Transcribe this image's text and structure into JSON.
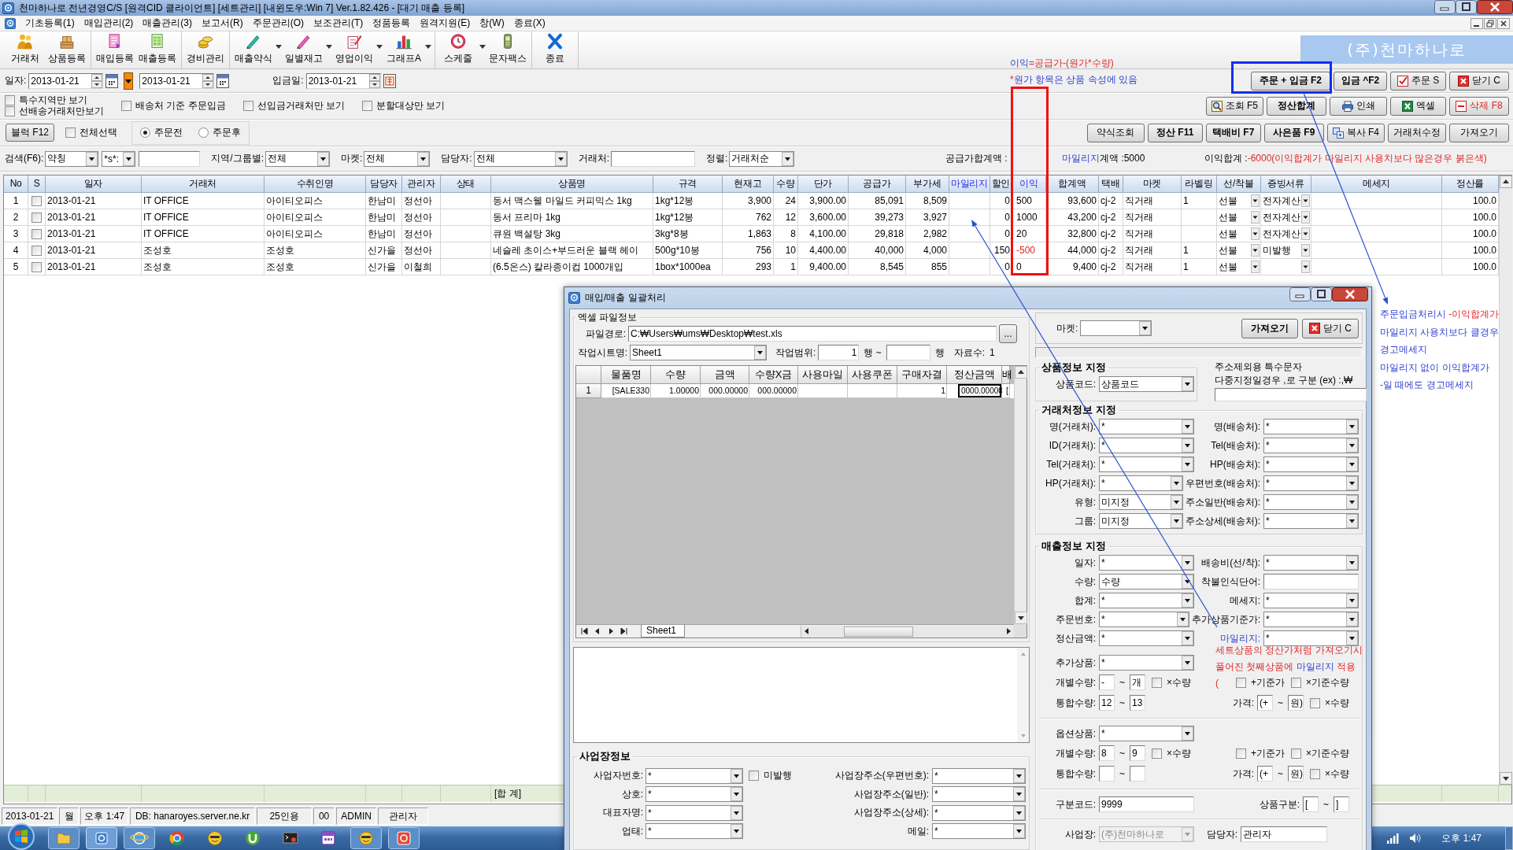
{
  "window": {
    "title": "천마하나로 전년경영C/S [원격CID 클라이언트] [세트관리] [내윈도우:Win 7] Ver.1.82.426 - [대기 매출 등록]",
    "menu": [
      "기초등록(1)",
      "매입관리(2)",
      "매출관리(3)",
      "보고서(R)",
      "주문관리(O)",
      "보조관리(T)",
      "정품등록",
      "원격지원(E)",
      "창(W)",
      "종료(X)"
    ]
  },
  "toolbar": [
    [
      {
        "label": "거래처",
        "kind": "customer",
        "dropdown": false
      },
      {
        "label": "상품등록",
        "kind": "product",
        "dropdown": false
      }
    ],
    [
      {
        "label": "매입등록",
        "kind": "purchase",
        "dropdown": false
      },
      {
        "label": "매출등록",
        "kind": "sales",
        "dropdown": false
      }
    ],
    [
      {
        "label": "경비관리",
        "kind": "expense",
        "dropdown": false
      }
    ],
    [
      {
        "label": "매출약식",
        "kind": "report",
        "dropdown": true
      },
      {
        "label": "일별재고",
        "kind": "stock",
        "dropdown": true
      },
      {
        "label": "영업이익",
        "kind": "profit",
        "dropdown": true
      },
      {
        "label": "그래프A",
        "kind": "graph",
        "dropdown": true
      }
    ],
    [
      {
        "label": "스케줄",
        "kind": "schedule",
        "dropdown": true
      },
      {
        "label": "문자팩스",
        "kind": "message",
        "dropdown": false
      }
    ],
    [
      {
        "label": "종료",
        "kind": "exit",
        "dropdown": false
      }
    ]
  ],
  "banner": "(주)천마하나로",
  "formula_note": [
    [
      {
        "text": "이익",
        "kind": "emphasis"
      },
      {
        "text": "=공급가-(원가*수량)",
        "kind": "warning"
      }
    ],
    [
      {
        "text": "*",
        "kind": "warning"
      },
      {
        "text": "원가 항목은 상품 속성에 있음",
        "kind": "emphasis"
      }
    ]
  ],
  "filters": {
    "date": {
      "label": "일자:",
      "from": "2013-01-21",
      "to": "2013-01-21"
    },
    "deposit": {
      "label": "입금일:",
      "value": "2013-01-21"
    },
    "checkbox_groups": [
      [
        {
          "label": "특수지역만 보기",
          "checked": false
        },
        {
          "label": "선배송거래처만보기",
          "checked": false
        }
      ],
      [
        {
          "label": "배송처 기준 주문입금",
          "checked": false
        }
      ],
      [
        {
          "label": "선입금거래처만 보기",
          "checked": false
        }
      ],
      [
        {
          "label": "분할대상만 보기",
          "checked": false
        }
      ]
    ],
    "block_button": "블럭 F12",
    "select_all": {
      "label": "전체선택",
      "checked": false
    },
    "order_state": [
      {
        "label": "주문전",
        "selected": true
      },
      {
        "label": "주문후",
        "selected": false
      }
    ],
    "search": [
      {
        "kind": "label",
        "text": "검색(F6):"
      },
      {
        "kind": "dropdown",
        "value": "약칭"
      },
      {
        "kind": "dropdown",
        "value": "*s*:"
      },
      {
        "kind": "input"
      },
      {
        "kind": "label",
        "text": "지역/그룹별:"
      },
      {
        "kind": "dropdown",
        "value": "전체"
      },
      {
        "kind": "label",
        "text": "마켓:"
      },
      {
        "kind": "dropdown",
        "value": "전체"
      },
      {
        "kind": "label",
        "text": "담당자:"
      },
      {
        "kind": "dropdown",
        "value": "전체"
      },
      {
        "kind": "label",
        "text": "거래처:"
      },
      {
        "kind": "input"
      },
      {
        "kind": "label",
        "text": "정렬:"
      },
      {
        "kind": "dropdown",
        "value": "거래처순"
      }
    ]
  },
  "action_buttons": [
    [
      {
        "label": "주문 + 입금 F2",
        "kind": "bold"
      },
      {
        "label": "입금 ^F2",
        "kind": "bold"
      },
      {
        "label": "주문 S",
        "kind": "check"
      },
      {
        "label": "닫기 C",
        "kind": "close"
      }
    ],
    [
      {
        "label": "조회 F5",
        "kind": "search"
      },
      {
        "label": "정산합계",
        "kind": "bold"
      },
      {
        "label": "인쇄",
        "kind": "print"
      },
      {
        "label": "엑셀",
        "kind": "excel"
      },
      {
        "label": "삭제 F8",
        "kind": "delete"
      }
    ],
    [
      {
        "label": "약식조회",
        "kind": "plain"
      },
      {
        "label": "정산 F11",
        "kind": "bold"
      },
      {
        "label": "택배비 F7",
        "kind": "bold"
      },
      {
        "label": "사은품 F9",
        "kind": "bold"
      },
      {
        "label": "복사 F4",
        "kind": "copy"
      },
      {
        "label": "거래처수정",
        "kind": "plain"
      },
      {
        "label": "가져오기",
        "kind": "plain"
      }
    ]
  ],
  "summary": [
    [
      {
        "text": "공급가합계액 :",
        "kind": "plain"
      }
    ],
    [
      {
        "text": "마일리지",
        "kind": "emphasis"
      },
      {
        "text": "계액 :5000",
        "kind": "plain"
      }
    ],
    [
      {
        "text": "이익합계 :",
        "kind": "plain"
      },
      {
        "text": "-6000(이익합계가 마일리지 사용치보다 많은경우 붉은색)",
        "kind": "warning"
      }
    ]
  ],
  "table": {
    "columns": [
      {
        "label": "No",
        "kind": "index",
        "highlight": false
      },
      {
        "label": "S",
        "kind": "check",
        "highlight": false
      },
      {
        "label": "일자",
        "kind": "text",
        "highlight": false
      },
      {
        "label": "거래처",
        "kind": "text",
        "highlight": false
      },
      {
        "label": "수취인명",
        "kind": "text",
        "highlight": false
      },
      {
        "label": "담당자",
        "kind": "text",
        "highlight": false
      },
      {
        "label": "관리자",
        "kind": "text",
        "highlight": false
      },
      {
        "label": "상태",
        "kind": "text",
        "highlight": false
      },
      {
        "label": "상품명",
        "kind": "text",
        "highlight": false
      },
      {
        "label": "규격",
        "kind": "text",
        "highlight": false
      },
      {
        "label": "현재고",
        "kind": "number",
        "highlight": false
      },
      {
        "label": "수량",
        "kind": "number",
        "highlight": false
      },
      {
        "label": "단가",
        "kind": "number",
        "highlight": false
      },
      {
        "label": "공급가",
        "kind": "number",
        "highlight": false
      },
      {
        "label": "부가세",
        "kind": "number",
        "highlight": false
      },
      {
        "label": "마일리지",
        "kind": "number",
        "highlight": true
      },
      {
        "label": "할인",
        "kind": "number",
        "highlight": false
      },
      {
        "label": "이익",
        "kind": "profit",
        "highlight": true
      },
      {
        "label": "합계액",
        "kind": "number",
        "highlight": false
      },
      {
        "label": "택배",
        "kind": "text",
        "highlight": false
      },
      {
        "label": "마켓",
        "kind": "text",
        "highlight": false
      },
      {
        "label": "라벨링",
        "kind": "text",
        "highlight": false
      },
      {
        "label": "선/착불",
        "kind": "dropdown",
        "highlight": false
      },
      {
        "label": "증빙서류",
        "kind": "dropdown",
        "highlight": false
      },
      {
        "label": "메세지",
        "kind": "text",
        "highlight": false
      },
      {
        "label": "정산률",
        "kind": "number",
        "highlight": false
      }
    ],
    "rows": [
      {
        "checked": false,
        "profit_warning": false,
        "cells": [
          "1",
          null,
          "2013-01-21",
          "IT OFFICE",
          "아이티오피스",
          "한남미",
          "정선아",
          null,
          "동서 맥스웰 마일드 커피믹스 1kg",
          "1kg*12봉",
          "3,900",
          "24",
          "3,900.00",
          "85,091",
          "8,509",
          null,
          "0",
          "500",
          "93,600",
          "cj-2",
          "직거래",
          "1",
          "선불",
          "전자계산",
          null,
          "100.0"
        ]
      },
      {
        "checked": false,
        "profit_warning": false,
        "cells": [
          "2",
          null,
          "2013-01-21",
          "IT OFFICE",
          "아이티오피스",
          "한남미",
          "정선아",
          null,
          "동서 프리마 1kg",
          "1kg*12봉",
          "762",
          "12",
          "3,600.00",
          "39,273",
          "3,927",
          null,
          "0",
          "1000",
          "43,200",
          "cj-2",
          "직거래",
          null,
          "선불",
          "전자계산",
          null,
          "100.0"
        ]
      },
      {
        "checked": false,
        "profit_warning": false,
        "cells": [
          "3",
          null,
          "2013-01-21",
          "IT OFFICE",
          "아이티오피스",
          "한남미",
          "정선아",
          null,
          "큐원 백설탕 3kg",
          "3kg*8봉",
          "1,863",
          "8",
          "4,100.00",
          "29,818",
          "2,982",
          null,
          "0",
          "20",
          "32,800",
          "cj-2",
          "직거래",
          null,
          "선불",
          "전자계산",
          null,
          "100.0"
        ]
      },
      {
        "checked": false,
        "profit_warning": true,
        "cells": [
          "4",
          null,
          "2013-01-21",
          "조성호",
          "조성호",
          "신가을",
          "정선아",
          null,
          "네슬레 초이스+부드러운 블랙 헤이",
          "500g*10봉",
          "756",
          "10",
          "4,400.00",
          "40,000",
          "4,000",
          null,
          "150",
          "-500",
          "44,000",
          "cj-2",
          "직거래",
          "1",
          "선불",
          "미발행",
          null,
          "100.0"
        ]
      },
      {
        "checked": false,
        "profit_warning": false,
        "cells": [
          "5",
          null,
          "2013-01-21",
          "조성호",
          "조성호",
          "신가을",
          "이철희",
          null,
          "(6.5온스) 칼라종이컵 1000개입",
          "1box*1000ea",
          "293",
          "1",
          "9,400.00",
          "8,545",
          "855",
          null,
          "0",
          "0",
          "9,400",
          "cj-2",
          "직거래",
          "1",
          "선불",
          null,
          null,
          "100.0"
        ]
      }
    ],
    "totals_label": "[합 계]"
  },
  "status_bar": [
    "2013-01-21",
    "월",
    "오후 1:47",
    "DB: hanaroyes.server.ne.kr",
    "25인용",
    "00",
    "ADMIN",
    "관리자"
  ],
  "taskbar": {
    "clock": "오후 1:47"
  },
  "side_note": [
    [
      {
        "text": "주문입금처리시",
        "kind": "emphasis"
      },
      {
        "text": " -이익합계가",
        "kind": "warning"
      }
    ],
    [
      {
        "text": "마일리지 사용치보다 클경우",
        "kind": "emphasis"
      }
    ],
    [
      {
        "text": "경고메세지",
        "kind": "emphasis"
      }
    ],
    [
      {
        "text": "마일리지 없이 이익합계가",
        "kind": "emphasis"
      }
    ],
    [
      {
        "text": "-일 때에도 경고메세지",
        "kind": "emphasis"
      }
    ]
  ],
  "dialog": {
    "title": "매입/매출 일괄처리",
    "excel": {
      "title": "엑셀 파일정보",
      "path_label": "파일경로:",
      "path": "C:₩Users₩ums₩Desktop₩test.xls",
      "browse": "...",
      "sheet_label": "작업시트명:",
      "sheet": "Sheet1",
      "range_label": "작업범위:",
      "range_from": "1",
      "range_mid": "행 ~",
      "range_end": "행",
      "count_label": "자료수:",
      "count": "1",
      "grid": {
        "columns": [
          "물품명",
          "수량",
          "금액",
          "수량X금",
          "사용마일",
          "사용쿠폰",
          "구매자결",
          "정산금액",
          "배"
        ],
        "rows": [
          {
            "header": "1",
            "cells": [
              {
                "text": "[SALE330",
                "selected": false
              },
              {
                "text": "1.00000",
                "selected": false
              },
              {
                "text": "000.00000",
                "selected": false
              },
              {
                "text": "000.00000",
                "selected": false
              },
              {
                "selected": false
              },
              {
                "selected": false
              },
              {
                "text": "1",
                "selected": false
              },
              {
                "text": "0000.00000",
                "selected": true
              },
              {
                "text": "[",
                "selected": false
              }
            ]
          }
        ],
        "sheet_tab": "Sheet1"
      }
    },
    "business": {
      "title": "사업장정보",
      "rows": [
        {
          "left": {
            "label": "사업자번호:",
            "value": "*"
          },
          "check": {
            "label": "미발행",
            "checked": false
          },
          "right": {
            "label": "사업장주소(우편번호):",
            "value": "*"
          }
        },
        {
          "left": {
            "label": "상호:",
            "value": "*"
          },
          "right": {
            "label": "사업장주소(일반):",
            "value": "*"
          }
        },
        {
          "left": {
            "label": "대표자명:",
            "value": "*"
          },
          "right": {
            "label": "사업장주소(상세):",
            "value": "*"
          }
        },
        {
          "left": {
            "label": "업태:",
            "value": "*"
          },
          "right": {
            "label": "메일:",
            "value": "*"
          }
        }
      ]
    },
    "market": {
      "label": "마켓:"
    },
    "buttons": [
      {
        "label": "가져오기",
        "kind": "bold"
      },
      {
        "label": "닫기 C",
        "kind": "close"
      }
    ],
    "product": {
      "title": "상품정보 지정",
      "label": "상품코드:",
      "value": "상품코드"
    },
    "special_chars": [
      "주소제외용 특수문자",
      "다중지정일경우 ,로 구분 (ex) :,₩"
    ],
    "customer": {
      "title": "거래처정보 지정",
      "rows": [
        [
          {
            "label": "명(거래처):",
            "value": "*",
            "kind": "dropdown"
          },
          {
            "label": "명(배송처):",
            "value": "*",
            "kind": "dropdown"
          }
        ],
        [
          {
            "label": "ID(거래처):",
            "value": "*",
            "kind": "dropdown"
          },
          {
            "label": "Tel(배송처):",
            "value": "*",
            "kind": "dropdown"
          }
        ],
        [
          {
            "label": "Tel(거래처):",
            "value": "*",
            "kind": "dropdown"
          },
          {
            "label": "HP(배송처):",
            "value": "*",
            "kind": "dropdown"
          }
        ],
        [
          {
            "label": "HP(거래처):",
            "value": "*",
            "kind": "dropdown"
          },
          {
            "label": "우편번호(배송처):",
            "value": "*",
            "kind": "dropdown"
          }
        ],
        [
          {
            "label": "유형:",
            "value": "미지정",
            "kind": "dropdown"
          },
          {
            "label": "주소일반(배송처):",
            "value": "*",
            "kind": "dropdown"
          }
        ],
        [
          {
            "label": "그룹:",
            "value": "미지정",
            "kind": "dropdown"
          },
          {
            "label": "주소상세(배송처):",
            "value": "*",
            "kind": "dropdown"
          }
        ]
      ]
    },
    "sales": {
      "title": "매출정보 지정",
      "rows": [
        [
          {
            "label": "일자:",
            "value": "*",
            "kind": "dropdown",
            "highlight": false
          },
          {
            "label": "배송비(선/착):",
            "value": "*",
            "kind": "dropdown",
            "highlight": false
          }
        ],
        [
          {
            "label": "수량:",
            "value": "수량",
            "kind": "dropdown",
            "highlight": false
          },
          {
            "label": "착불인식단어:",
            "kind": "input",
            "highlight": false
          }
        ],
        [
          {
            "label": "합계:",
            "value": "*",
            "kind": "dropdown",
            "highlight": false
          },
          {
            "label": "메세지:",
            "value": "*",
            "kind": "dropdown",
            "highlight": false
          }
        ],
        [
          {
            "label": "주문번호:",
            "value": "*",
            "kind": "dropdown",
            "highlight": false
          },
          {
            "label": "추가상품기준가:",
            "value": "*",
            "kind": "dropdown",
            "highlight": false
          }
        ],
        [
          {
            "label": "정산금액:",
            "value": "*",
            "kind": "dropdown",
            "highlight": false
          },
          {
            "label": "마일리지:",
            "value": "*",
            "kind": "dropdown",
            "highlight": true
          }
        ]
      ]
    },
    "extras": [
      {
        "label": "추가상품:",
        "value": "*",
        "each": {
          "label": "개별수량:",
          "from": "-",
          "sep": "~",
          "to": "개",
          "times": {
            "label": "×수량",
            "checked": false
          }
        },
        "flags": [
          {
            "label": "+기준가",
            "checked": false
          },
          {
            "label": "×기준수량",
            "checked": false
          }
        ],
        "total": {
          "label": "통합수량:",
          "from": "12",
          "sep": "~",
          "to": "13"
        },
        "price": {
          "label": "가격:",
          "from": "(+",
          "sep": "~",
          "to": "원)",
          "times": {
            "label": "×수량",
            "checked": false
          }
        }
      },
      {
        "label": "옵션상품:",
        "value": "*",
        "each": {
          "label": "개별수량:",
          "from": "8",
          "sep": "~",
          "to": "9",
          "times": {
            "label": "×수량",
            "checked": false
          }
        },
        "flags": [
          {
            "label": "+기준가",
            "checked": false
          },
          {
            "label": "×기준수량",
            "checked": false
          }
        ],
        "total": {
          "label": "통합수량:",
          "sep": "~"
        },
        "price": {
          "label": "가격:",
          "from": "(+",
          "sep": "~",
          "to": "원)",
          "times": {
            "label": "×수량",
            "checked": false
          }
        }
      }
    ],
    "code": {
      "label": "구분코드:",
      "value": "9999",
      "category_label": "상품구분:",
      "category_from": "[",
      "category_sep": "~",
      "category_to": "]"
    },
    "site": {
      "label": "사업장:",
      "value": "(주)천마하나로",
      "disabled": true,
      "manager_label": "담당자:",
      "manager": "관리자"
    },
    "note": [
      [
        {
          "text": "세트상품의 정산가처럼 가져오기시",
          "kind": "warning"
        }
      ],
      [
        {
          "text": "풀어진 첫째상품에 ",
          "kind": "warning"
        },
        {
          "text": "마일리지",
          "kind": "emphasis"
        },
        {
          "text": " 적용",
          "kind": "warning"
        }
      ],
      [
        {
          "text": "(",
          "kind": "warning"
        }
      ]
    ]
  }
}
